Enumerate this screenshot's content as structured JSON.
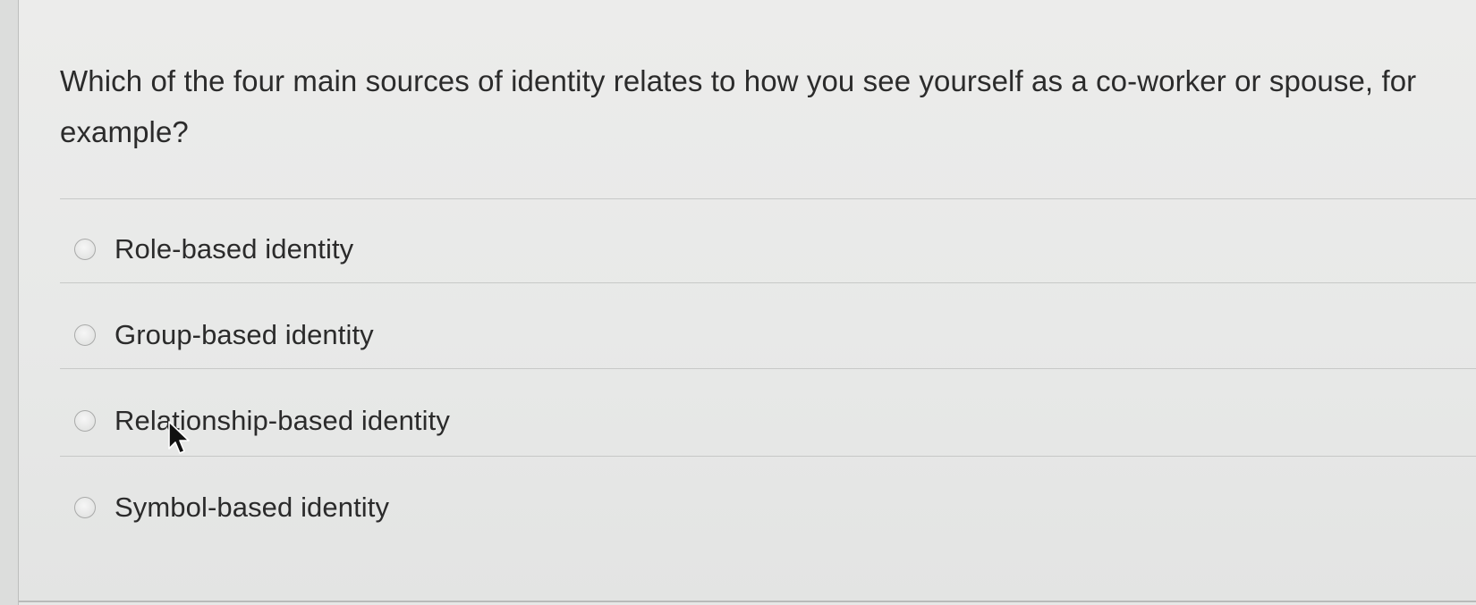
{
  "question": {
    "text": "Which of the four main sources of identity relates to how you see yourself as a co-worker or spouse, for example?"
  },
  "options": [
    {
      "label": "Role-based identity",
      "selected": false
    },
    {
      "label": "Group-based identity",
      "selected": false
    },
    {
      "label": "Relationship-based identity",
      "selected": false
    },
    {
      "label": "Symbol-based identity",
      "selected": false
    }
  ],
  "cursor": {
    "icon": "mouse-pointer-icon"
  }
}
